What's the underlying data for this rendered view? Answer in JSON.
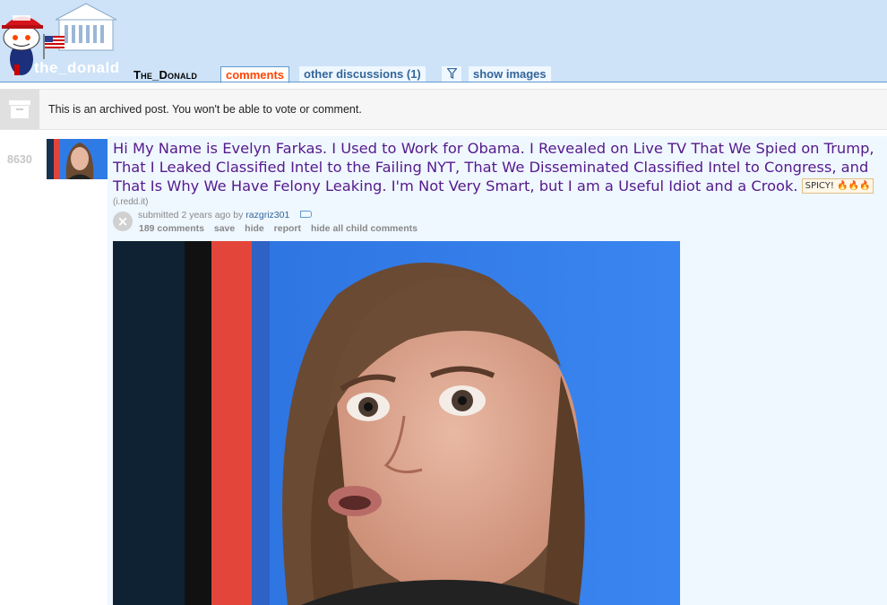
{
  "header": {
    "subreddit_logo_text": "the_donald",
    "subreddit_name": "The_Donald",
    "tabs": [
      {
        "label": "comments",
        "selected": true
      },
      {
        "label": "other discussions (1)",
        "selected": false
      },
      {
        "label": "show images",
        "selected": false
      }
    ],
    "filter_icon": "funnel-icon"
  },
  "archived_notice": {
    "icon": "archive-box-icon",
    "text": "This is an archived post. You won't be able to vote or comment."
  },
  "post": {
    "score": "8630",
    "title": "Hi My Name is Evelyn Farkas. I Used to Work for Obama. I Revealed on Live TV That We Spied on Trump, That I Leaked Classified Intel to the Failing NYT, That We Disseminated Classified Intel to Congress, and That Is Why We Have Felony Leaking. I'm Not Very Smart, but I am a Useful Idiot and a Crook.",
    "flair": "SPICY! 🔥🔥🔥",
    "domain": "(i.redd.it)",
    "submitted_prefix": "submitted",
    "time_ago": "2 years ago",
    "by_label": "by",
    "author": "razgriz301",
    "actions": [
      "189 comments",
      "save",
      "hide",
      "report",
      "hide all child comments"
    ]
  },
  "colors": {
    "header_bg": "#cee3f8",
    "link_visited": "#551a8b",
    "selected_tab": "#ff4500",
    "tab_text": "#336699",
    "entry_bg": "#eff7ff"
  }
}
